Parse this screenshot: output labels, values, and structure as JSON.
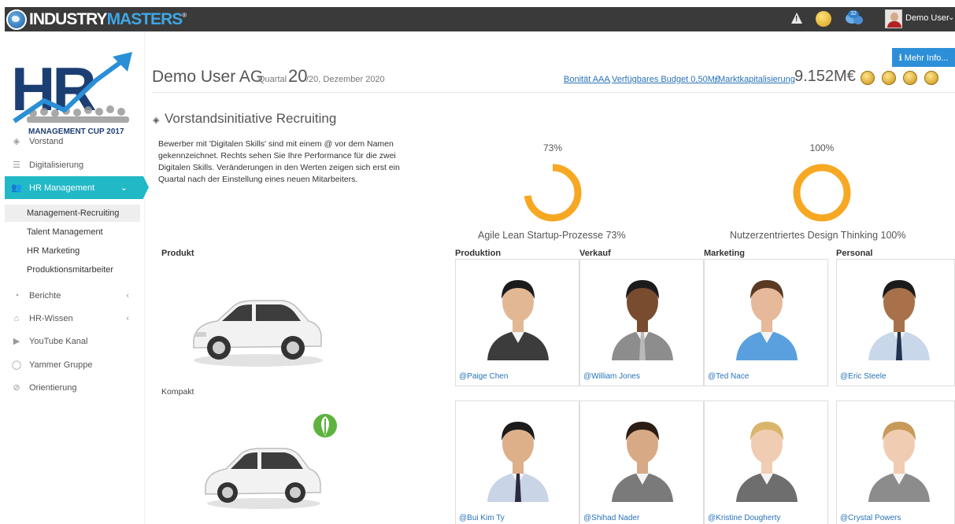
{
  "topbar": {
    "brand_a": "INDUSTRY",
    "brand_b": "MASTERS",
    "brand_reg": "®",
    "user_name": "Demo User",
    "caret": "⌄",
    "chat_badge": "32"
  },
  "logo": {
    "letters": "HR",
    "subtitle": "MANAGEMENT CUP 2017"
  },
  "sidebar": {
    "items": [
      {
        "label": "Vorstand",
        "icon": "diamond-icon"
      },
      {
        "label": "Digitalisierung",
        "icon": "database-icon"
      },
      {
        "label": "HR Management",
        "icon": "users-icon",
        "active": true,
        "chev": "⌄"
      },
      {
        "label": "Berichte",
        "icon": "dashboard-icon",
        "chev": "‹"
      },
      {
        "label": "HR-Wissen",
        "icon": "graduation-cap-icon",
        "chev": "‹"
      },
      {
        "label": "YouTube Kanal",
        "icon": "youtube-icon"
      },
      {
        "label": "Yammer Gruppe",
        "icon": "comment-icon"
      },
      {
        "label": "Orientierung",
        "icon": "compass-icon"
      }
    ],
    "subitems": [
      {
        "label": "Management-Recruiting",
        "active": true
      },
      {
        "label": "Talent Management"
      },
      {
        "label": "HR Marketing"
      },
      {
        "label": "Produktionsmitarbeiter"
      }
    ]
  },
  "header": {
    "company": "Demo User AG",
    "quartal_label": "Quartal",
    "quartal_num": "20",
    "quartal_rest": "/20, Dezember 2020",
    "bonitaet": "Bonität AAA",
    "sep1": ",",
    "budget": "Verfügbares Budget 0,50M€",
    "sep2": ",",
    "mcap_label": "Marktkapitalisierung",
    "mcap_value": "9.152M€",
    "more_info": "ℹ Mehr Info..."
  },
  "section": {
    "title": "Vorstandsinitiative Recruiting",
    "description": "Bewerber mit 'Digitalen Skills' sind mit einem @ vor dem Namen gekennzeichnet. Rechts sehen Sie Ihre Performance für die zwei Digitalen Skills. Veränderungen in den Werten zeigen sich erst ein Quartal nach der Einstellung eines neuen Mitarbeiters."
  },
  "gauges": [
    {
      "pct_label": "73%",
      "value": 73,
      "label": "Agile Lean Startup-Prozesse 73%"
    },
    {
      "pct_label": "100%",
      "value": 100,
      "label": "Nutzerzentriertes Design Thinking 100%"
    }
  ],
  "colors": {
    "accent": "#22b9c7",
    "gauge": "#f7a823",
    "link": "#2a73b8",
    "button": "#2d8fd8"
  },
  "product": {
    "heading": "Produkt",
    "compact_label": "Kompakt"
  },
  "columns": [
    "Produktion",
    "Verkauf",
    "Marketing",
    "Personal"
  ],
  "candidates": [
    [
      {
        "handle": "@Paige Chen",
        "skin": "#e2b894",
        "hair": "#1b1b1b",
        "shirt": "#3c3c3c",
        "tie": ""
      },
      {
        "handle": "@William Jones",
        "skin": "#7a4c2f",
        "hair": "#1b1b1b",
        "shirt": "#8d8d8d",
        "tie": "#b9b9b9"
      },
      {
        "handle": "@Ted Nace",
        "skin": "#e5b99a",
        "hair": "#5a3a22",
        "shirt": "#5aa0df",
        "tie": ""
      },
      {
        "handle": "@Eric Steele",
        "skin": "#a8714a",
        "hair": "#1b1b1b",
        "shirt": "#c8d8ea",
        "tie": "#1f3350"
      }
    ],
    [
      {
        "handle": "@Bui Kim Ty",
        "skin": "#ddb08a",
        "hair": "#1b1b1b",
        "shirt": "#c9d4e6",
        "tie": "#2a2a40"
      },
      {
        "handle": "@Shihad Nader",
        "skin": "#d8a985",
        "hair": "#2b1d14",
        "shirt": "#7a7a7a",
        "tie": ""
      },
      {
        "handle": "@Kristine Dougherty",
        "skin": "#f0cdb2",
        "hair": "#d8b56a",
        "shirt": "#6e6e6e",
        "tie": ""
      },
      {
        "handle": "@Crystal Powers",
        "skin": "#f0cdb2",
        "hair": "#c89a5a",
        "shirt": "#8c8c8c",
        "tie": ""
      }
    ]
  ]
}
